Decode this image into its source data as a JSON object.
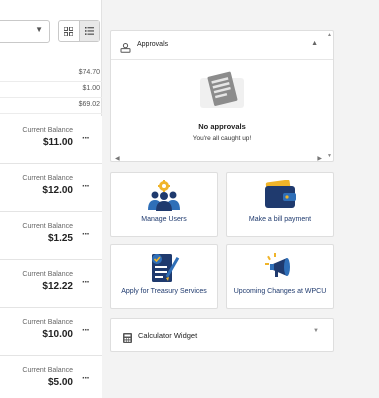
{
  "left_panel": {
    "mini_rows": [
      {
        "amount": "$74.70"
      },
      {
        "amount": "$1.00"
      },
      {
        "amount": "$69.02"
      }
    ],
    "accounts": [
      {
        "label": "Current Balance",
        "balance": "$11.00"
      },
      {
        "label": "Current Balance",
        "balance": "$12.00"
      },
      {
        "label": "Current Balance",
        "balance": "$1.25"
      },
      {
        "label": "Current Balance",
        "balance": "$12.22"
      },
      {
        "label": "Current Balance",
        "balance": "$10.00"
      },
      {
        "label": "Current Balance",
        "balance": "$5.00"
      }
    ],
    "more_glyph": "···"
  },
  "approvals": {
    "title": "Approvals",
    "empty_title": "No approvals",
    "empty_subtitle": "You're all caught up!"
  },
  "tiles": [
    {
      "label": "Manage Users",
      "icon": "users-gear-icon"
    },
    {
      "label": "Make a bill payment",
      "icon": "wallet-icon"
    },
    {
      "label": "Apply for Treasury Services",
      "icon": "application-form-icon"
    },
    {
      "label": "Upcoming Changes at WPCU",
      "icon": "megaphone-icon"
    }
  ],
  "calculator": {
    "title": "Calculator Widget"
  },
  "colors": {
    "navy": "#1f3a6e",
    "accent_blue": "#2f6fb8",
    "gold": "#f0b429",
    "green": "#3aa655"
  }
}
